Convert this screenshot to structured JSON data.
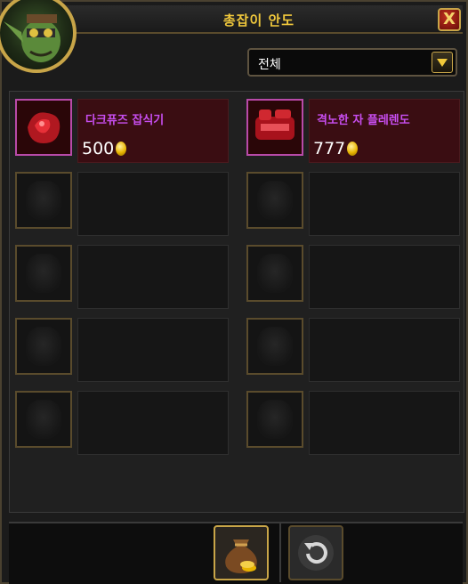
{
  "window": {
    "title": "총잡이 안도",
    "close_label": "X"
  },
  "filter": {
    "selected": "전체"
  },
  "items": [
    {
      "name": "다크퓨즈 잡식기",
      "price": "500",
      "currency_icon": "gold-coin-icon",
      "icon": "red-gem-icon"
    },
    {
      "name": "격노한 자 플레렌도",
      "price": "777",
      "currency_icon": "gold-coin-icon",
      "icon": "red-gauntlet-icon"
    }
  ],
  "footer": {
    "bag_icon": "money-bag-icon",
    "refresh_icon": "refresh-icon"
  },
  "colors": {
    "title": "#f0c83c",
    "item_name": "#c84ef0",
    "frame_gold": "#c8a548"
  }
}
